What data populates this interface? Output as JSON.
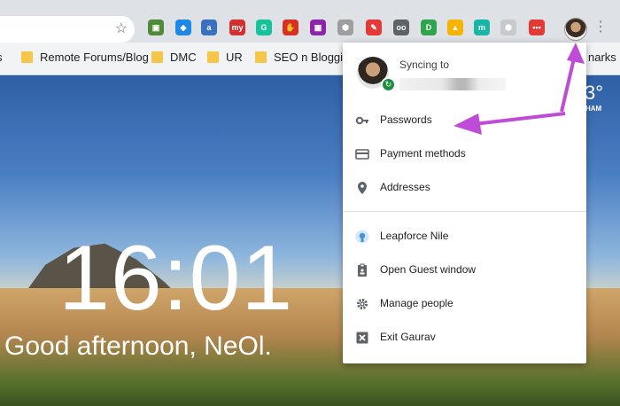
{
  "toolbar": {
    "extensions": [
      {
        "name": "photo-extension-icon",
        "glyph": "▣",
        "color": "#4f8a3b"
      },
      {
        "name": "diamond-extension-icon",
        "glyph": "◆",
        "color": "#1e88e5"
      },
      {
        "name": "amazon-extension-icon",
        "glyph": "a",
        "color": "#3b6fbf"
      },
      {
        "name": "my-extension-icon",
        "glyph": "my",
        "color": "#d32f2f"
      },
      {
        "name": "grammarly-extension-icon",
        "glyph": "G",
        "color": "#15c39a"
      },
      {
        "name": "stop-extension-icon",
        "glyph": "✋",
        "color": "#d93025"
      },
      {
        "name": "grid-extension-icon",
        "glyph": "▦",
        "color": "#8e24aa"
      },
      {
        "name": "shield-extension-icon",
        "glyph": "⬢",
        "color": "#9e9e9e"
      },
      {
        "name": "pen-extension-icon",
        "glyph": "✎",
        "color": "#e53935"
      },
      {
        "name": "tape-extension-icon",
        "glyph": "oo",
        "color": "#5f6368"
      },
      {
        "name": "d-extension-icon",
        "glyph": "D",
        "color": "#2ea44f"
      },
      {
        "name": "drive-extension-icon",
        "glyph": "▲",
        "color": "#f4b400"
      },
      {
        "name": "m-extension-icon",
        "glyph": "m",
        "color": "#18b6a4"
      },
      {
        "name": "shield-gray-extension-icon",
        "glyph": "⬢",
        "color": "#c7c9cc"
      },
      {
        "name": "more-extension-icon",
        "glyph": "•••",
        "color": "#e53935"
      }
    ]
  },
  "bookmarks": [
    {
      "label": "s",
      "folder": false
    },
    {
      "label": "Remote Forums/Blog",
      "folder": true
    },
    {
      "label": "DMC",
      "folder": true
    },
    {
      "label": "UR",
      "folder": true
    },
    {
      "label": "SEO n Blogging",
      "folder": true
    },
    {
      "label": "narks",
      "folder": false
    }
  ],
  "background": {
    "clock": "16:01",
    "greeting": "Good afternoon, NeOl.",
    "temperature": "3°",
    "temperature_location": "HAM"
  },
  "profile_menu": {
    "sync_label": "Syncing to",
    "items": [
      {
        "label": "Passwords",
        "icon": "key-icon"
      },
      {
        "label": "Payment methods",
        "icon": "credit-card-icon"
      },
      {
        "label": "Addresses",
        "icon": "location-pin-icon"
      },
      {
        "label": "Leapforce Nile",
        "icon": "user-profile-icon"
      },
      {
        "label": "Open Guest window",
        "icon": "guest-badge-icon"
      },
      {
        "label": "Manage people",
        "icon": "gear-icon"
      },
      {
        "label": "Exit Gaurav",
        "icon": "exit-icon"
      }
    ]
  },
  "colors": {
    "accent": "#c04bd6",
    "sync_green": "#1e8e3e",
    "toolbar": "#dee1e6"
  }
}
